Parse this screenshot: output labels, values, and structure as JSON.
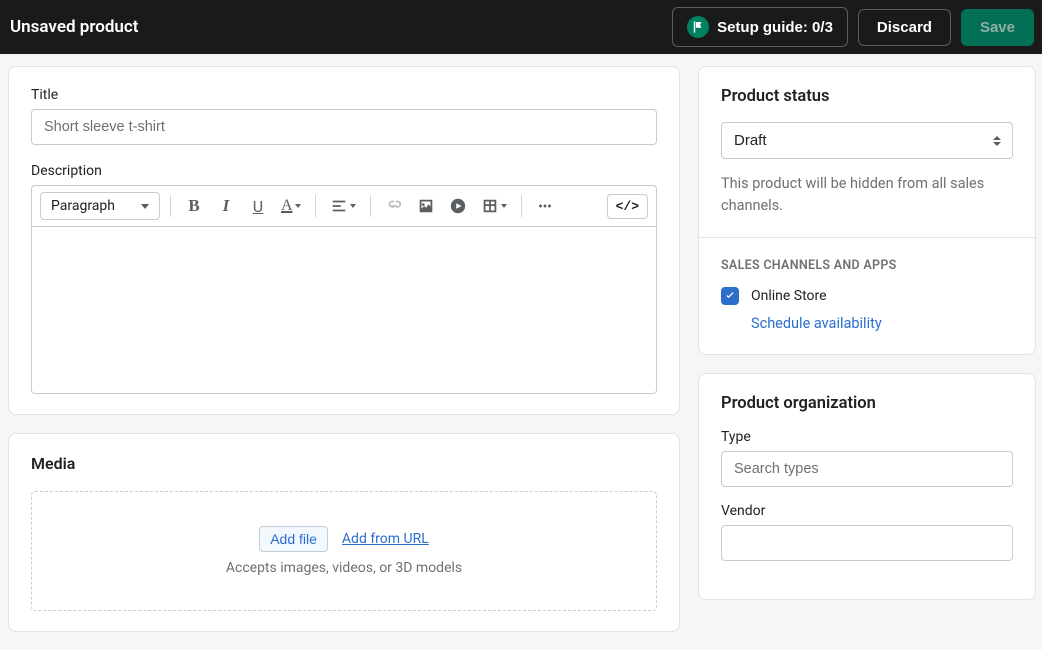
{
  "topbar": {
    "title": "Unsaved product",
    "setup_guide_label": "Setup guide: 0/3",
    "discard_label": "Discard",
    "save_label": "Save"
  },
  "main": {
    "title_label": "Title",
    "title_placeholder": "Short sleeve t-shirt",
    "description_label": "Description",
    "rte": {
      "paragraph_label": "Paragraph",
      "code_toggle": "</>"
    },
    "media": {
      "heading": "Media",
      "add_file": "Add file",
      "add_from_url": "Add from URL",
      "hint": "Accepts images, videos, or 3D models"
    }
  },
  "status": {
    "heading": "Product status",
    "selected": "Draft",
    "hint": "This product will be hidden from all sales channels.",
    "channels_heading": "SALES CHANNELS AND APPS",
    "channel_online_store": "Online Store",
    "schedule_label": "Schedule availability"
  },
  "organization": {
    "heading": "Product organization",
    "type_label": "Type",
    "type_placeholder": "Search types",
    "vendor_label": "Vendor"
  }
}
